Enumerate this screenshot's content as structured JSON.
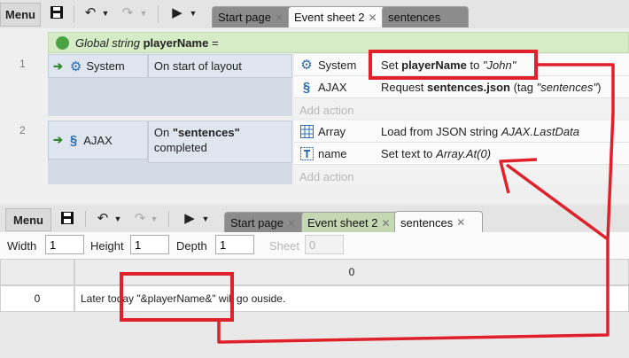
{
  "top_toolbar": {
    "menu_label": "Menu",
    "tabs": [
      {
        "label": "Start page",
        "close": "✕"
      },
      {
        "label": "Event sheet 2",
        "close": "✕"
      },
      {
        "label": "sentences",
        "close": ""
      }
    ]
  },
  "event_sheet": {
    "global_var": {
      "prefix": "Global string",
      "name": "playerName",
      "suffix": "="
    },
    "events": [
      {
        "number": "1",
        "condition": {
          "object": "System",
          "text": "On start of layout"
        },
        "actions": [
          {
            "object": "System",
            "pre": "Set ",
            "bold": "playerName",
            "mid": " to ",
            "italic": "\"John\"",
            "post": ""
          },
          {
            "object": "AJAX",
            "pre": "Request ",
            "bold": "sentences.json",
            "mid": " (tag ",
            "italic": "\"sentences\"",
            "post": ")"
          }
        ],
        "add_action": "Add action"
      },
      {
        "number": "2",
        "condition": {
          "object": "AJAX",
          "pre": "On ",
          "bold": "\"sentences\"",
          "line2": "completed"
        },
        "actions": [
          {
            "object": "Array",
            "pre": "Load from JSON string ",
            "italic": "AJAX.LastData"
          },
          {
            "object": "name",
            "pre": "Set text to ",
            "italic": "Array.At(0)"
          }
        ],
        "add_action": "Add action"
      }
    ]
  },
  "bottom_toolbar": {
    "menu_label": "Menu",
    "tabs": [
      {
        "label": "Start page",
        "close": "✕"
      },
      {
        "label": "Event sheet 2",
        "close": "✕"
      },
      {
        "label": "sentences",
        "close": "✕"
      }
    ]
  },
  "array_props": {
    "width_label": "Width",
    "width_value": "1",
    "height_label": "Height",
    "height_value": "1",
    "depth_label": "Depth",
    "depth_value": "1",
    "sheet_label": "Sheet",
    "sheet_value": "0"
  },
  "grid": {
    "column_header": "0",
    "rows": [
      {
        "index": "0",
        "value": "Later today \"&playerName&\" will go ouside."
      }
    ]
  },
  "colors": {
    "annotation": "#e0202a",
    "accent_green": "#2f8a2f"
  },
  "icons": [
    "save-icon",
    "undo-icon",
    "redo-icon",
    "play-icon",
    "gear-icon",
    "ajax-icon",
    "array-icon",
    "text-icon",
    "globe-icon"
  ]
}
